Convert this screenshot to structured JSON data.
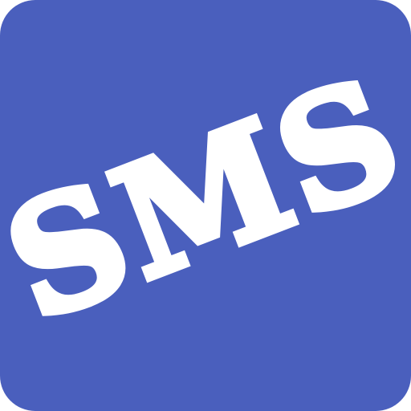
{
  "icon": {
    "label": "SMS",
    "background_color": "#4a5fbd",
    "text_color": "#ffffff"
  }
}
